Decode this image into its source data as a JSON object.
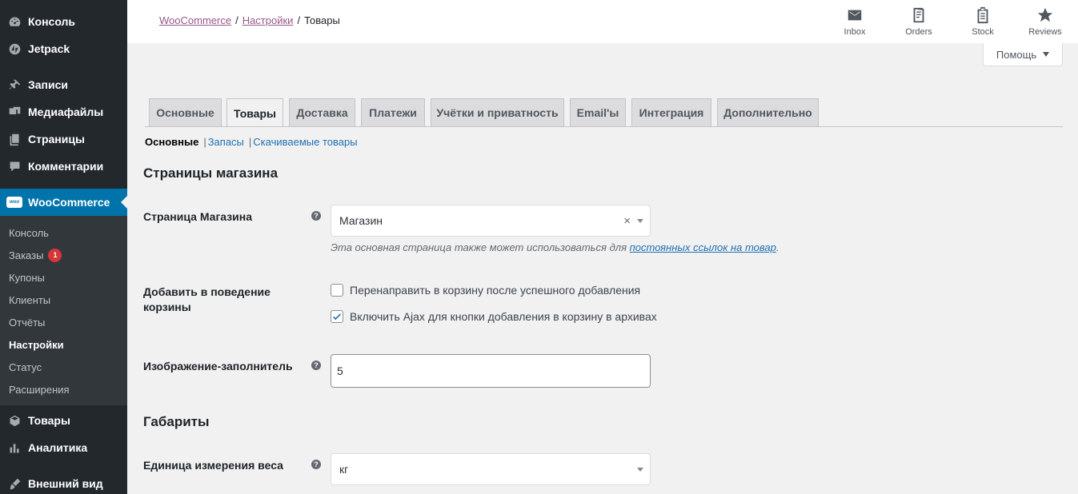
{
  "sidebar": {
    "top_items": [
      {
        "label": "Консоль",
        "icon": "dashboard-icon"
      },
      {
        "label": "Jetpack",
        "icon": "jetpack-icon"
      },
      {
        "label": "Записи",
        "icon": "pin-icon"
      },
      {
        "label": "Медиафайлы",
        "icon": "media-icon"
      },
      {
        "label": "Страницы",
        "icon": "pages-icon"
      },
      {
        "label": "Комментарии",
        "icon": "comments-icon"
      }
    ],
    "woocommerce": {
      "label": "WooCommerce",
      "logo_text": "woo"
    },
    "submenu": [
      {
        "label": "Консоль"
      },
      {
        "label": "Заказы",
        "badge": "1"
      },
      {
        "label": "Купоны"
      },
      {
        "label": "Клиенты"
      },
      {
        "label": "Отчёты"
      },
      {
        "label": "Настройки"
      },
      {
        "label": "Статус"
      },
      {
        "label": "Расширения"
      }
    ],
    "bottom_items": [
      {
        "label": "Товары",
        "icon": "box-icon"
      },
      {
        "label": "Аналитика",
        "icon": "chart-icon"
      },
      {
        "label": "Внешний вид",
        "icon": "brush-icon"
      }
    ],
    "colors": {
      "bg": "#23282d",
      "active": "#0073aa",
      "submenu_bg": "#32373c"
    }
  },
  "header": {
    "breadcrumb": [
      "WooCommerce",
      "Настройки",
      "Товары"
    ],
    "breadcrumb_sep": "/",
    "activity": [
      {
        "label": "Inbox",
        "icon": "inbox-icon"
      },
      {
        "label": "Orders",
        "icon": "orders-icon"
      },
      {
        "label": "Stock",
        "icon": "stock-icon"
      },
      {
        "label": "Reviews",
        "icon": "star-icon"
      }
    ],
    "help_label": "Помощь"
  },
  "tabs": [
    "Основные",
    "Товары",
    "Доставка",
    "Платежи",
    "Учётки и приватность",
    "Email'ы",
    "Интеграция",
    "Дополнительно"
  ],
  "active_tab": "Товары",
  "subsections": [
    "Основные",
    "Запасы",
    "Скачиваемые товары"
  ],
  "sections": {
    "shop_pages": {
      "title": "Страницы магазина",
      "shop_page_label": "Страница Магазина",
      "shop_page_value": "Магазин",
      "shop_page_clear": "×",
      "desc_text": "Эта основная страница также может использоваться для",
      "desc_link": "постоянных ссылок на товар",
      "desc_end": ".",
      "cart_label": "Добавить в поведение корзины",
      "checkbox_redirect": {
        "label": "Перенаправить в корзину после успешного добавления",
        "checked": false
      },
      "checkbox_ajax": {
        "label": "Включить Ajax для кнопки добавления в корзину в архивах",
        "checked": true
      },
      "placeholder_label": "Изображение-заполнитель",
      "placeholder_value": "5"
    },
    "dimensions": {
      "title": "Габариты",
      "weight_label": "Единица измерения веса",
      "weight_value": "кг"
    }
  },
  "help_tip_glyph": "?"
}
